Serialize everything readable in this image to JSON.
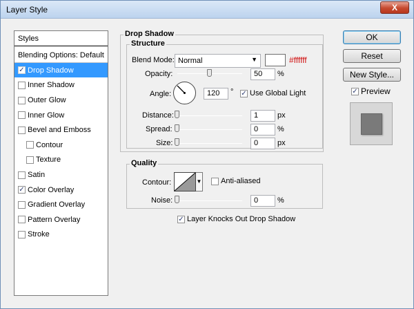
{
  "window": {
    "title": "Layer Style",
    "close_label": "X"
  },
  "styles_panel": {
    "header": "Styles",
    "blending_options": "Blending Options: Default",
    "items": [
      {
        "label": "Drop Shadow",
        "checked": true,
        "selected": true,
        "sub": false
      },
      {
        "label": "Inner Shadow",
        "checked": false,
        "selected": false,
        "sub": false
      },
      {
        "label": "Outer Glow",
        "checked": false,
        "selected": false,
        "sub": false
      },
      {
        "label": "Inner Glow",
        "checked": false,
        "selected": false,
        "sub": false
      },
      {
        "label": "Bevel and Emboss",
        "checked": false,
        "selected": false,
        "sub": false
      },
      {
        "label": "Contour",
        "checked": false,
        "selected": false,
        "sub": true
      },
      {
        "label": "Texture",
        "checked": false,
        "selected": false,
        "sub": true
      },
      {
        "label": "Satin",
        "checked": false,
        "selected": false,
        "sub": false
      },
      {
        "label": "Color Overlay",
        "checked": true,
        "selected": false,
        "sub": false
      },
      {
        "label": "Gradient Overlay",
        "checked": false,
        "selected": false,
        "sub": false
      },
      {
        "label": "Pattern Overlay",
        "checked": false,
        "selected": false,
        "sub": false
      },
      {
        "label": "Stroke",
        "checked": false,
        "selected": false,
        "sub": false
      }
    ]
  },
  "drop_shadow": {
    "group_title": "Drop Shadow",
    "structure_title": "Structure",
    "blend_mode_label": "Blend Mode:",
    "blend_mode_value": "Normal",
    "color_hex": "#ffffff",
    "opacity_label": "Opacity:",
    "opacity_value": "50",
    "opacity_unit": "%",
    "angle_label": "Angle:",
    "angle_value": "120",
    "angle_unit": "°",
    "use_global_light_label": "Use Global Light",
    "use_global_light_checked": true,
    "distance_label": "Distance:",
    "distance_value": "1",
    "distance_unit": "px",
    "spread_label": "Spread:",
    "spread_value": "0",
    "spread_unit": "%",
    "size_label": "Size:",
    "size_value": "0",
    "size_unit": "px"
  },
  "quality": {
    "group_title": "Quality",
    "contour_label": "Contour:",
    "anti_aliased_label": "Anti-aliased",
    "anti_aliased_checked": false,
    "noise_label": "Noise:",
    "noise_value": "0",
    "noise_unit": "%",
    "knocks_out_label": "Layer Knocks Out Drop Shadow",
    "knocks_out_checked": true
  },
  "buttons": {
    "ok": "OK",
    "reset": "Reset",
    "new_style": "New Style...",
    "preview_label": "Preview",
    "preview_checked": true
  },
  "colors": {
    "selection": "#3399ff",
    "hex_text": "#d01010",
    "check_mark": "#2b3a70"
  }
}
